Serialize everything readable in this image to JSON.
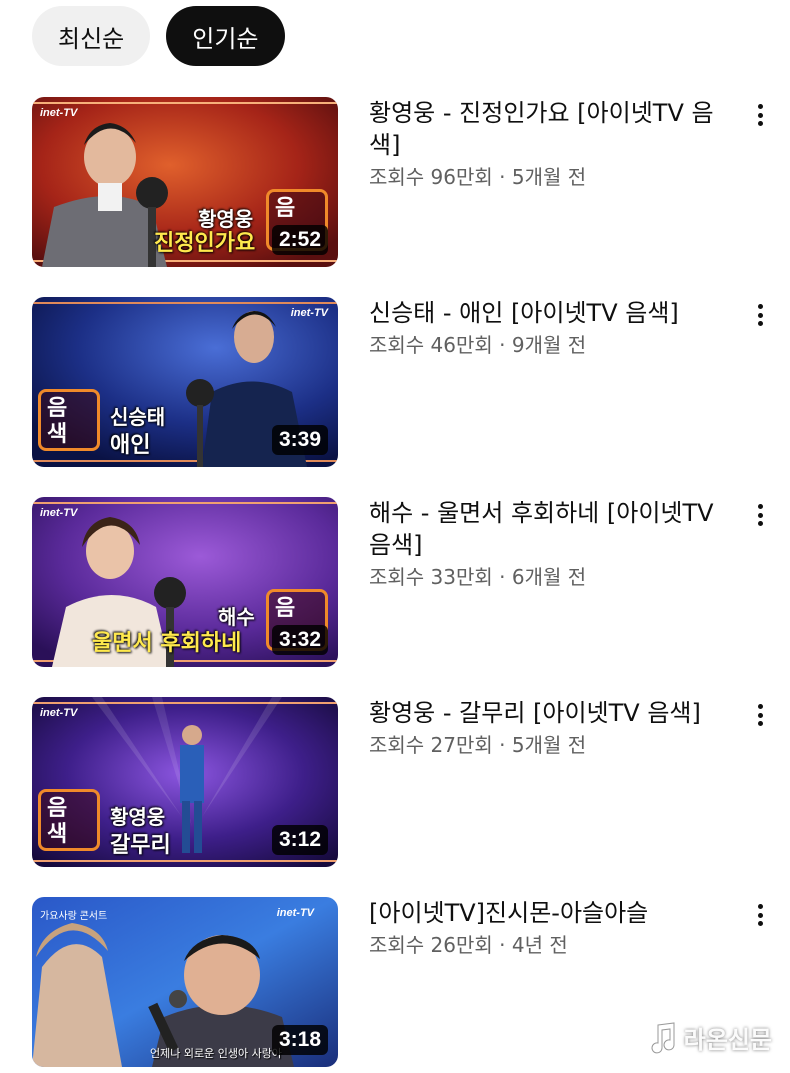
{
  "chips": [
    {
      "label": "최신순",
      "active": false
    },
    {
      "label": "인기순",
      "active": true
    }
  ],
  "videos": [
    {
      "title": "황영웅 - 진정인가요 [아이넷TV 음색]",
      "meta": "조회수 96만회 · 5개월 전",
      "duration": "2:52",
      "overlay_name": "황영웅",
      "overlay_song": "진정인가요",
      "channel_logo": "inet-TV"
    },
    {
      "title": "신승태 - 애인 [아이넷TV 음색]",
      "meta": "조회수 46만회 · 9개월 전",
      "duration": "3:39",
      "overlay_name": "신승태",
      "overlay_song": "애인",
      "channel_logo": "inet-TV"
    },
    {
      "title": "해수 - 울면서 후회하네 [아이넷TV 음색]",
      "meta": "조회수 33만회 · 6개월 전",
      "duration": "3:32",
      "overlay_name": "해수",
      "overlay_song": "울면서 후회하네",
      "channel_logo": "inet-TV"
    },
    {
      "title": "황영웅 - 갈무리 [아이넷TV 음색]",
      "meta": "조회수 27만회 · 5개월 전",
      "duration": "3:12",
      "overlay_name": "황영웅",
      "overlay_song": "갈무리",
      "channel_logo": "inet-TV"
    },
    {
      "title": "[아이넷TV]진시몬-아슬아슬",
      "meta": "조회수 26만회 · 4년 전",
      "duration": "3:18",
      "caption": "언제나 외로운 인생아 사랑아",
      "channel_logo": "inet-TV",
      "corner_text": "가요사랑 콘서트"
    }
  ],
  "badge_text": [
    "음",
    "색"
  ],
  "watermark": "라온신문",
  "colors": {
    "chip_active_bg": "#0f0f0f",
    "chip_inactive_bg": "#f0f0f0",
    "meta_text": "#606060",
    "song_overlay": "#ffe94d",
    "badge_border": "#f08a2a"
  }
}
